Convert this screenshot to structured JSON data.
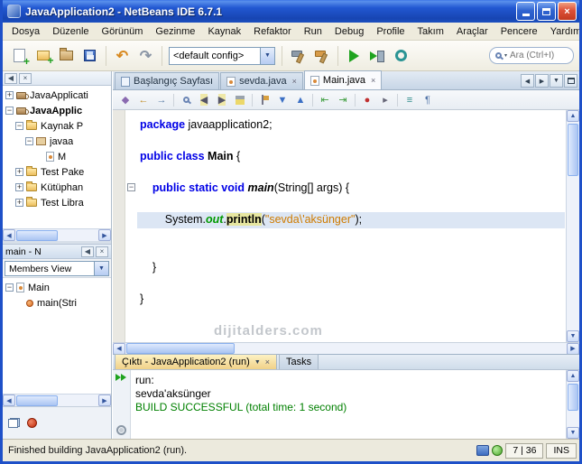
{
  "window": {
    "title": "JavaApplication2 - NetBeans IDE 6.7.1",
    "watermark": "dijitalders.com"
  },
  "menu": {
    "items": [
      "Dosya",
      "Düzenle",
      "Görünüm",
      "Gezinme",
      "Kaynak",
      "Refaktor",
      "Run",
      "Debug",
      "Profile",
      "Takım",
      "Araçlar",
      "Pencere",
      "Yardım"
    ]
  },
  "toolbar": {
    "config_value": "<default config>",
    "search_placeholder": "Ara (Ctrl+I)",
    "icons_file": [
      "new-file",
      "new-project",
      "open-project",
      "save-all"
    ],
    "icons_edit": [
      "undo",
      "redo"
    ],
    "icons_build": [
      "build",
      "clean-build"
    ],
    "icons_run": [
      "run",
      "debug",
      "profile"
    ]
  },
  "projects_panel": {
    "tree": [
      {
        "label": "JavaApplicati",
        "icon": "project",
        "level": 0,
        "expander": "plus"
      },
      {
        "label": "JavaApplic",
        "icon": "project",
        "level": 0,
        "expander": "minus",
        "bold": true
      },
      {
        "label": "Kaynak P",
        "icon": "folder",
        "level": 1,
        "expander": "minus"
      },
      {
        "label": "javaa",
        "icon": "package",
        "level": 2,
        "expander": "minus"
      },
      {
        "label": "M",
        "icon": "class",
        "level": 3
      },
      {
        "label": "Test Pake",
        "icon": "folder",
        "level": 1,
        "expander": "plus"
      },
      {
        "label": "Kütüphan",
        "icon": "folder",
        "level": 1,
        "expander": "plus"
      },
      {
        "label": "Test Libra",
        "icon": "folder",
        "level": 1,
        "expander": "plus"
      }
    ]
  },
  "navigator_panel": {
    "title": "main - N",
    "combo_value": "Members View",
    "tree": [
      {
        "label": "Main",
        "icon": "class",
        "level": 0,
        "expander": "minus"
      },
      {
        "label": "main(Stri",
        "icon": "method",
        "level": 1
      }
    ]
  },
  "editor": {
    "tabs": [
      {
        "label": "Başlangıç Sayfası",
        "icon": "page",
        "closable": false,
        "active": false
      },
      {
        "label": "sevda.java",
        "icon": "java",
        "closable": true,
        "active": false
      },
      {
        "label": "Main.java",
        "icon": "java",
        "closable": true,
        "active": true
      }
    ],
    "toolbar_icons": [
      {
        "name": "last-edit-location-icon",
        "g": "◆",
        "c": "#8a6ab0"
      },
      {
        "name": "back-icon",
        "g": "←",
        "c": "#c08a20"
      },
      {
        "name": "forward-icon",
        "g": "→",
        "c": "#5b7ea6"
      },
      {
        "name": "sep"
      },
      {
        "name": "find-icon",
        "shape": "mag"
      },
      {
        "name": "find-previous-occurrence-icon",
        "g": "◀",
        "c": "#555566",
        "bg": "#efe8a8"
      },
      {
        "name": "find-next-occurrence-icon",
        "g": "▶",
        "c": "#555566",
        "bg": "#efe8a8"
      },
      {
        "name": "toggle-highlight-icon",
        "shape": "marker"
      },
      {
        "name": "sep"
      },
      {
        "name": "toggle-bookmark-icon",
        "shape": "flag"
      },
      {
        "name": "next-bookmark-icon",
        "g": "▼",
        "c": "#3b6fc4"
      },
      {
        "name": "previous-bookmark-icon",
        "g": "▲",
        "c": "#3b6fc4"
      },
      {
        "name": "sep"
      },
      {
        "name": "shift-left-icon",
        "g": "⇤",
        "c": "#3f9e3f"
      },
      {
        "name": "shift-right-icon",
        "g": "⇥",
        "c": "#3f9e3f"
      },
      {
        "name": "sep"
      },
      {
        "name": "record-macro-icon",
        "g": "●",
        "c": "#c03030"
      },
      {
        "name": "run-macro-icon",
        "g": "▸",
        "c": "#666677"
      },
      {
        "name": "sep"
      },
      {
        "name": "comment-icon",
        "g": "≡",
        "c": "#2e8b8b"
      },
      {
        "name": "format-icon",
        "g": "¶",
        "c": "#5577aa"
      }
    ],
    "code_lines": [
      {
        "seg": [
          {
            "t": "package",
            "s": "kw"
          },
          {
            "t": " javaapplication2;",
            "s": "pl"
          }
        ]
      },
      {
        "seg": []
      },
      {
        "seg": [
          {
            "t": "public class",
            "s": "kw"
          },
          {
            "t": " ",
            "s": "pl"
          },
          {
            "t": "Main",
            "s": "cdecl"
          },
          {
            "t": " {",
            "s": "pl"
          }
        ]
      },
      {
        "seg": []
      },
      {
        "fold": true,
        "seg": [
          {
            "t": "    ",
            "s": "pl"
          },
          {
            "t": "public static void",
            "s": "kw"
          },
          {
            "t": " ",
            "s": "pl"
          },
          {
            "t": "main",
            "s": "mdecl"
          },
          {
            "t": "(String[] args) {",
            "s": "pl"
          }
        ]
      },
      {
        "seg": []
      },
      {
        "hl": true,
        "seg": [
          {
            "t": "        System.",
            "s": "pl"
          },
          {
            "t": "out",
            "s": "field"
          },
          {
            "t": ".",
            "s": "pl"
          },
          {
            "t": "println",
            "s": "occ"
          },
          {
            "t": "(",
            "s": "pl"
          },
          {
            "t": "\"sevda\\'aksünger\"",
            "s": "str"
          },
          {
            "t": ");",
            "s": "pl"
          }
        ]
      },
      {
        "seg": []
      },
      {
        "seg": []
      },
      {
        "seg": [
          {
            "t": "    }",
            "s": "pl"
          }
        ]
      },
      {
        "seg": []
      },
      {
        "seg": [
          {
            "t": "}",
            "s": "pl"
          }
        ]
      }
    ]
  },
  "output_panel": {
    "tabs": [
      {
        "label": "Çıktı - JavaApplication2 (run)",
        "active": true
      },
      {
        "label": "Tasks",
        "active": false
      }
    ],
    "lines": [
      {
        "text": "run:",
        "c": "pl"
      },
      {
        "text": "sevda'aksünger",
        "c": "pl"
      },
      {
        "text": "BUILD SUCCESSFUL (total time: 1 second)",
        "c": "success"
      }
    ]
  },
  "status_bar": {
    "message": "Finished building JavaApplication2 (run).",
    "caret": "7 | 36",
    "mode": "INS"
  }
}
